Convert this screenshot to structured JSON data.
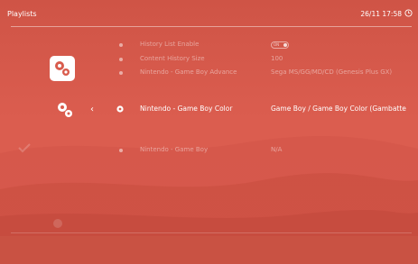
{
  "header": {
    "title": "Playlists",
    "clock": "26/11 17:58"
  },
  "menu": {
    "rows": [
      {
        "label": "History List Enable",
        "value": ""
      },
      {
        "label": "Content History Size",
        "value": "100"
      },
      {
        "label": "Nintendo - Game Boy Advance",
        "value": "Sega MS/GG/MD/CD (Genesis Plus GX)"
      },
      {
        "label": "Nintendo - Game Boy Color",
        "value": "Game Boy / Game Boy Color (Gambatte"
      },
      {
        "label": "Nintendo - Game Boy",
        "value": "N/A"
      }
    ],
    "toggle_text": "ON",
    "selected_index": 3
  },
  "icons": {
    "settings": "settings-gear-icon",
    "submenu": "small-gears-icon",
    "back": "chevron-left-icon",
    "clock": "clock-icon",
    "row": "gear-dot-icon"
  },
  "colors": {
    "background": "#d95c4d",
    "text": "#ffffff"
  }
}
